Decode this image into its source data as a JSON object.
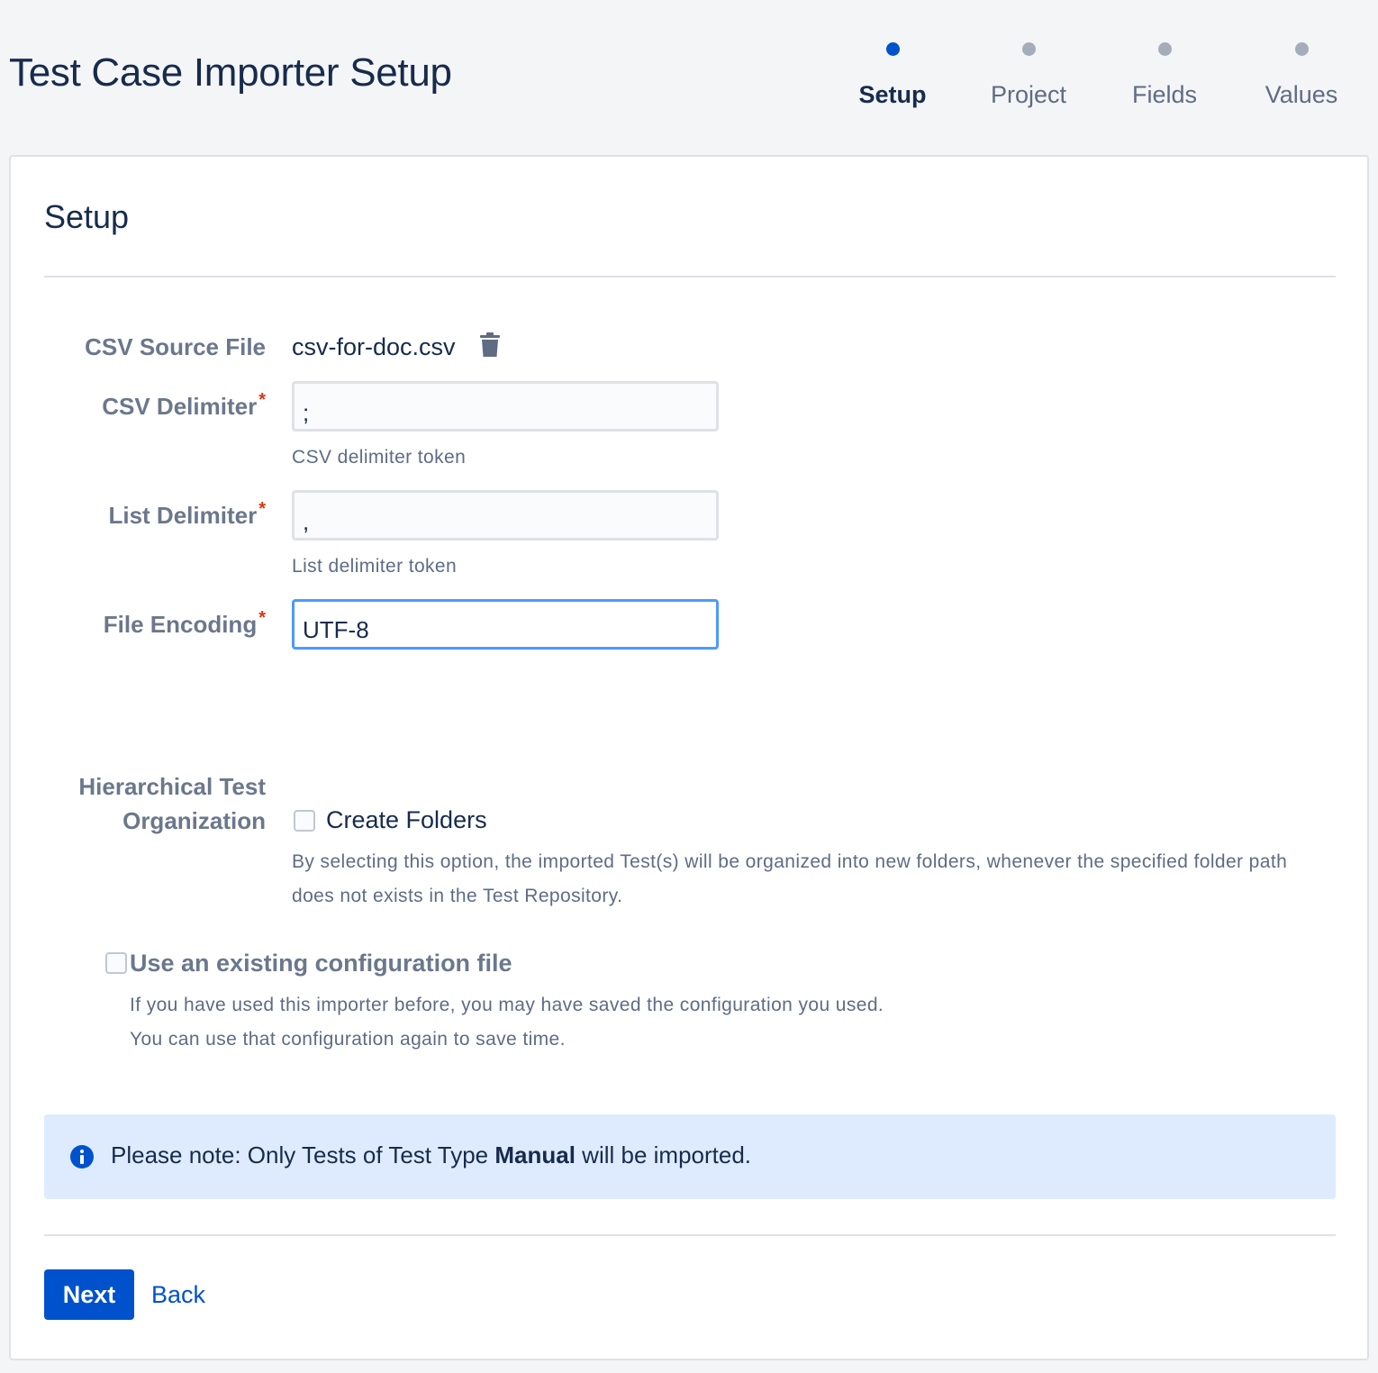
{
  "page": {
    "title": "Test Case Importer Setup"
  },
  "steps": [
    {
      "label": "Setup",
      "active": true
    },
    {
      "label": "Project",
      "active": false
    },
    {
      "label": "Fields",
      "active": false
    },
    {
      "label": "Values",
      "active": false
    }
  ],
  "card": {
    "title": "Setup"
  },
  "form": {
    "source_file": {
      "label": "CSV Source File",
      "value": "csv-for-doc.csv",
      "delete_icon": "trash-icon"
    },
    "csv_delimiter": {
      "label": "CSV Delimiter",
      "required_mark": "*",
      "value": ";",
      "help": "CSV delimiter token"
    },
    "list_delimiter": {
      "label": "List Delimiter",
      "required_mark": "*",
      "value": ",",
      "help": "List delimiter token"
    },
    "file_encoding": {
      "label": "File Encoding",
      "required_mark": "*",
      "value": "UTF-8"
    },
    "hierarchy": {
      "label_line1": "Hierarchical Test",
      "label_line2": "Organization",
      "checkbox_label": "Create Folders",
      "checked": false,
      "desc_line1": "By selecting this option, the imported Test(s) will be organized into new folders, whenever the specified folder path",
      "desc_line2": "does not exists in the Test Repository."
    },
    "existing_config": {
      "checkbox_label": "Use an existing configuration file",
      "checked": false,
      "desc_line1": "If you have used this importer before, you may have saved the configuration you used.",
      "desc_line2": "You can use that configuration again to save time."
    }
  },
  "note": {
    "icon": "info-icon",
    "text_before": "Please note: Only Tests of Test Type ",
    "text_bold": "Manual",
    "text_after": " will be imported."
  },
  "actions": {
    "next_label": "Next",
    "back_label": "Back"
  },
  "colors": {
    "primary": "#0052cc",
    "active_step": "#0052cc",
    "inactive_step": "#a5adba",
    "required": "#de350b",
    "note_bg": "#deebff",
    "focus_border": "#4c9aff"
  }
}
